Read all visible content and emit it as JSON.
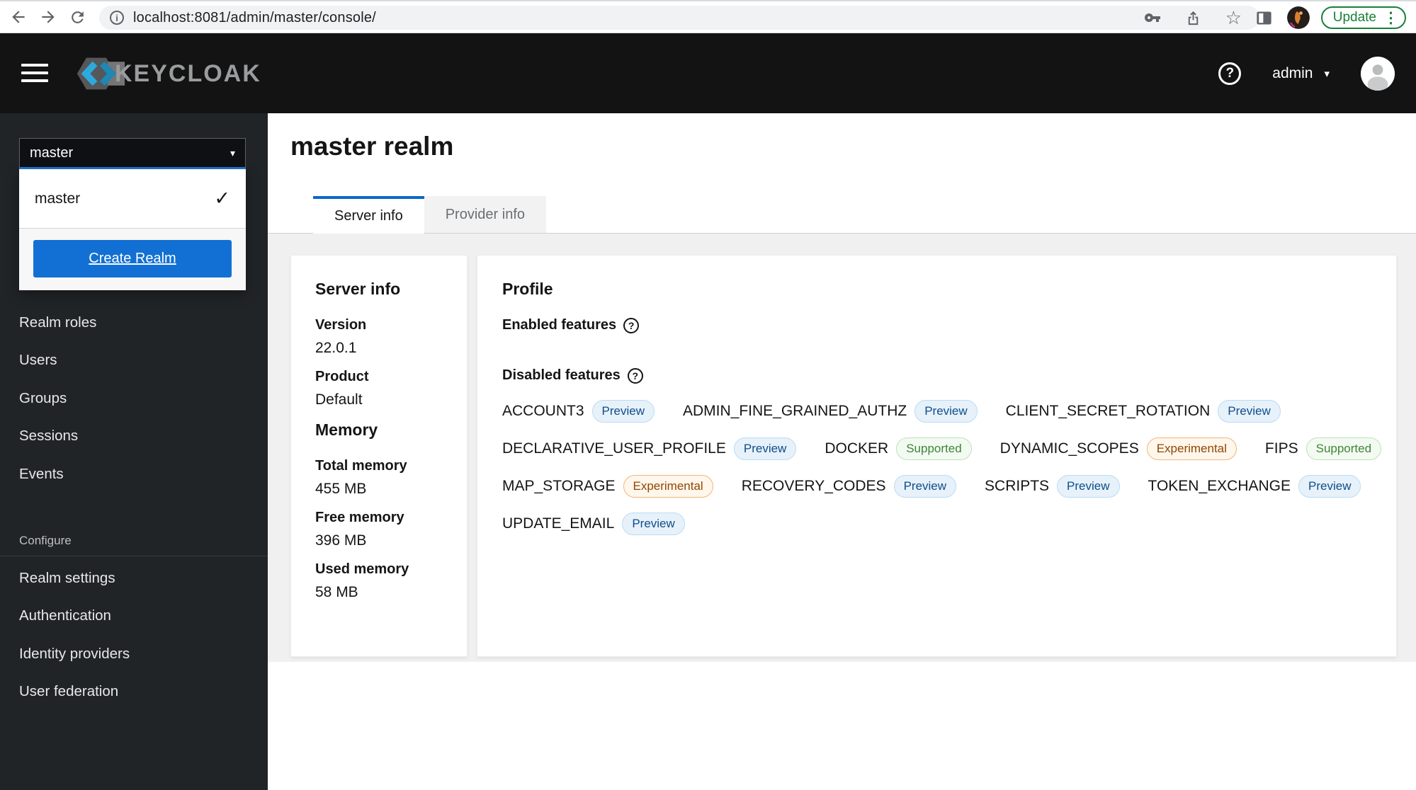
{
  "browser": {
    "url": "localhost:8081/admin/master/console/",
    "update_label": "Update"
  },
  "masthead": {
    "brand": "KEYCLOAK",
    "username": "admin"
  },
  "sidebar": {
    "realm_selector_value": "master",
    "dropdown": {
      "selected_item": "master",
      "create_realm_label": "Create Realm"
    },
    "nav_items": [
      "Realm roles",
      "Users",
      "Groups",
      "Sessions",
      "Events"
    ],
    "configure_label": "Configure",
    "configure_items": [
      "Realm settings",
      "Authentication",
      "Identity providers",
      "User federation"
    ]
  },
  "page": {
    "title": "master realm",
    "tabs": [
      "Server info",
      "Provider info"
    ]
  },
  "server_info": {
    "title": "Server info",
    "rows": [
      {
        "label": "Version",
        "value": "22.0.1"
      },
      {
        "label": "Product",
        "value": "Default"
      }
    ],
    "memory_title": "Memory",
    "memory_rows": [
      {
        "label": "Total memory",
        "value": "455 MB"
      },
      {
        "label": "Free memory",
        "value": "396 MB"
      },
      {
        "label": "Used memory",
        "value": "58 MB"
      }
    ]
  },
  "profile": {
    "title": "Profile",
    "enabled_label": "Enabled features",
    "disabled_label": "Disabled features",
    "enabled_features": [],
    "disabled_rows": [
      [
        {
          "name": "ACCOUNT3",
          "badge": "Preview"
        },
        {
          "name": "ADMIN_FINE_GRAINED_AUTHZ",
          "badge": "Preview"
        },
        {
          "name": "CLIENT_SECRET_ROTATION",
          "badge": "Preview"
        }
      ],
      [
        {
          "name": "DECLARATIVE_USER_PROFILE",
          "badge": "Preview"
        },
        {
          "name": "DOCKER",
          "badge": "Supported"
        },
        {
          "name": "DYNAMIC_SCOPES",
          "badge": "Experimental"
        },
        {
          "name": "FIPS",
          "badge": "Supported"
        }
      ],
      [
        {
          "name": "MAP_STORAGE",
          "badge": "Experimental"
        },
        {
          "name": "RECOVERY_CODES",
          "badge": "Preview"
        },
        {
          "name": "SCRIPTS",
          "badge": "Preview"
        },
        {
          "name": "TOKEN_EXCHANGE",
          "badge": "Preview"
        }
      ],
      [
        {
          "name": "UPDATE_EMAIL",
          "badge": "Preview"
        }
      ]
    ]
  },
  "icons": {
    "caret_down": "▾",
    "check": "✓",
    "question": "?",
    "star": "☆",
    "dots": "⋮",
    "info": "i"
  },
  "colors": {
    "tab_accent": "#0c66c9",
    "primary_button": "#1270d4",
    "select_focus": "#2176d9",
    "update_green": "#188038",
    "badge_preview": {
      "bg": "#e7f1fa",
      "border": "#b9dcf5",
      "text": "#0e4e8a"
    },
    "badge_supported": {
      "bg": "#f3faf2",
      "border": "#bde2b9",
      "text": "#3e8635"
    },
    "badge_experimental": {
      "bg": "#fff6ec",
      "border": "#f4b678",
      "text": "#8f4700"
    }
  }
}
